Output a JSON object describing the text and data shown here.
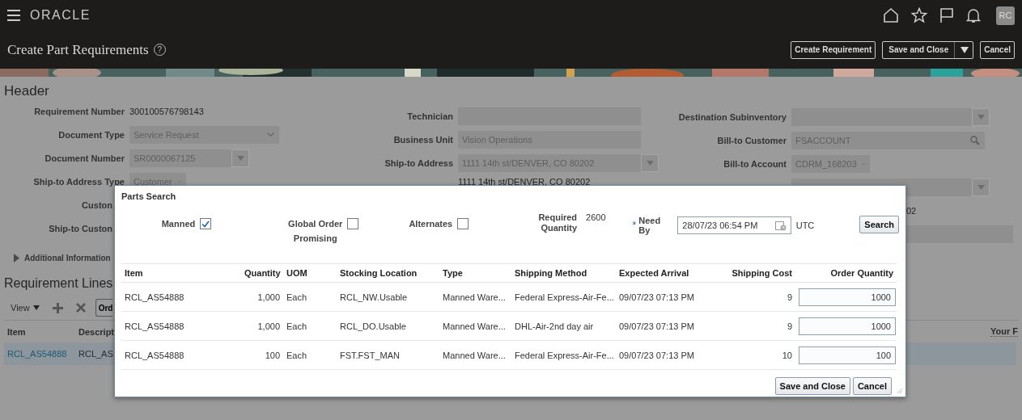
{
  "topbar": {
    "logo": "ORACLE",
    "avatar": "RC"
  },
  "page": {
    "title": "Create Part Requirements",
    "help": "?",
    "buttons": [
      {
        "label": "Create Requirement",
        "kind": "plain"
      },
      {
        "label": "Save and Close",
        "kind": "split"
      },
      {
        "label": "Cancel",
        "kind": "plain"
      }
    ]
  },
  "header": {
    "title": "Header",
    "left": [
      {
        "label": "Requirement Number",
        "kind": "text",
        "value": "300100576798143"
      },
      {
        "label": "Document Type",
        "kind": "select",
        "value": "Service Request"
      },
      {
        "label": "Document Number",
        "kind": "lov",
        "value": "SR0000067125"
      },
      {
        "label": "Ship-to Address Type",
        "kind": "select",
        "value": "Customer"
      },
      {
        "label": "Custon",
        "kind": "label"
      },
      {
        "label": "Ship-to Custon",
        "kind": "label"
      }
    ],
    "middle": [
      {
        "label": "Technician",
        "kind": "input"
      },
      {
        "label": "Business Unit",
        "kind": "input",
        "value": "Vision Operations"
      },
      {
        "label": "Ship-to Address",
        "kind": "lov",
        "value": "1111 14th st/DENVER, CO 80202"
      },
      {
        "kind": "text",
        "value": "1111 14th st/DENVER, CO 80202"
      }
    ],
    "right": [
      {
        "label": "Destination Subinventory",
        "kind": "lov"
      },
      {
        "label": "Bill-to Customer",
        "kind": "search",
        "value": "FSACCOUNT"
      },
      {
        "label": "Bill-to Account",
        "kind": "select",
        "value": "CDRM_168203"
      },
      {
        "kind": "lov"
      },
      {
        "kind": "tail",
        "value": "02"
      },
      {
        "kind": "input"
      }
    ],
    "disclosure": {
      "label": "Additional Information",
      "expanded": false
    }
  },
  "lines": {
    "title": "Requirement Lines",
    "view": "View",
    "tool_button": "Ord",
    "columns": [
      "Item",
      "Descript",
      "Your F"
    ],
    "rows": [
      {
        "item": "RCL_AS54888",
        "description": "RCL_AS",
        "selected": true
      }
    ]
  },
  "dialog": {
    "title": "Parts Search",
    "options": [
      {
        "label": "Manned",
        "checked": true
      },
      {
        "label": "Global Order",
        "label_2": "Promising",
        "checked": false
      },
      {
        "label": "Alternates",
        "checked": false
      }
    ],
    "required_quantity": {
      "label": "Required Quantity",
      "value": "2600"
    },
    "need_by": {
      "marker": "*",
      "label": "Need By",
      "value": "28/07/23 06:54 PM",
      "timezone": "UTC"
    },
    "search_button": "Search",
    "table": {
      "columns": [
        "Item",
        "Quantity",
        "UOM",
        "Stocking Location",
        "Type",
        "Shipping Method",
        "Expected Arrival",
        "Shipping Cost",
        "Order Quantity"
      ],
      "rows": [
        {
          "item": "RCL_AS54888",
          "quantity": "1,000",
          "uom": "Each",
          "location": "RCL_NW.Usable",
          "type": "Manned Ware...",
          "method": "Federal Express-Air-Fe...",
          "arrival": "09/07/23 07:13 PM",
          "cost": "9",
          "order_quantity": "1000"
        },
        {
          "item": "RCL_AS54888",
          "quantity": "1,000",
          "uom": "Each",
          "location": "RCL_DO.Usable",
          "type": "Manned Ware...",
          "method": "DHL-Air-2nd day air",
          "arrival": "09/07/23 07:13 PM",
          "cost": "9",
          "order_quantity": "1000"
        },
        {
          "item": "RCL_AS54888",
          "quantity": "100",
          "uom": "Each",
          "location": "FST.FST_MAN",
          "type": "Manned Ware...",
          "method": "Federal Express-Air-Fe...",
          "arrival": "09/07/23 07:13 PM",
          "cost": "10",
          "order_quantity": "100"
        }
      ]
    },
    "buttons": [
      "Save and Close",
      "Cancel"
    ]
  }
}
